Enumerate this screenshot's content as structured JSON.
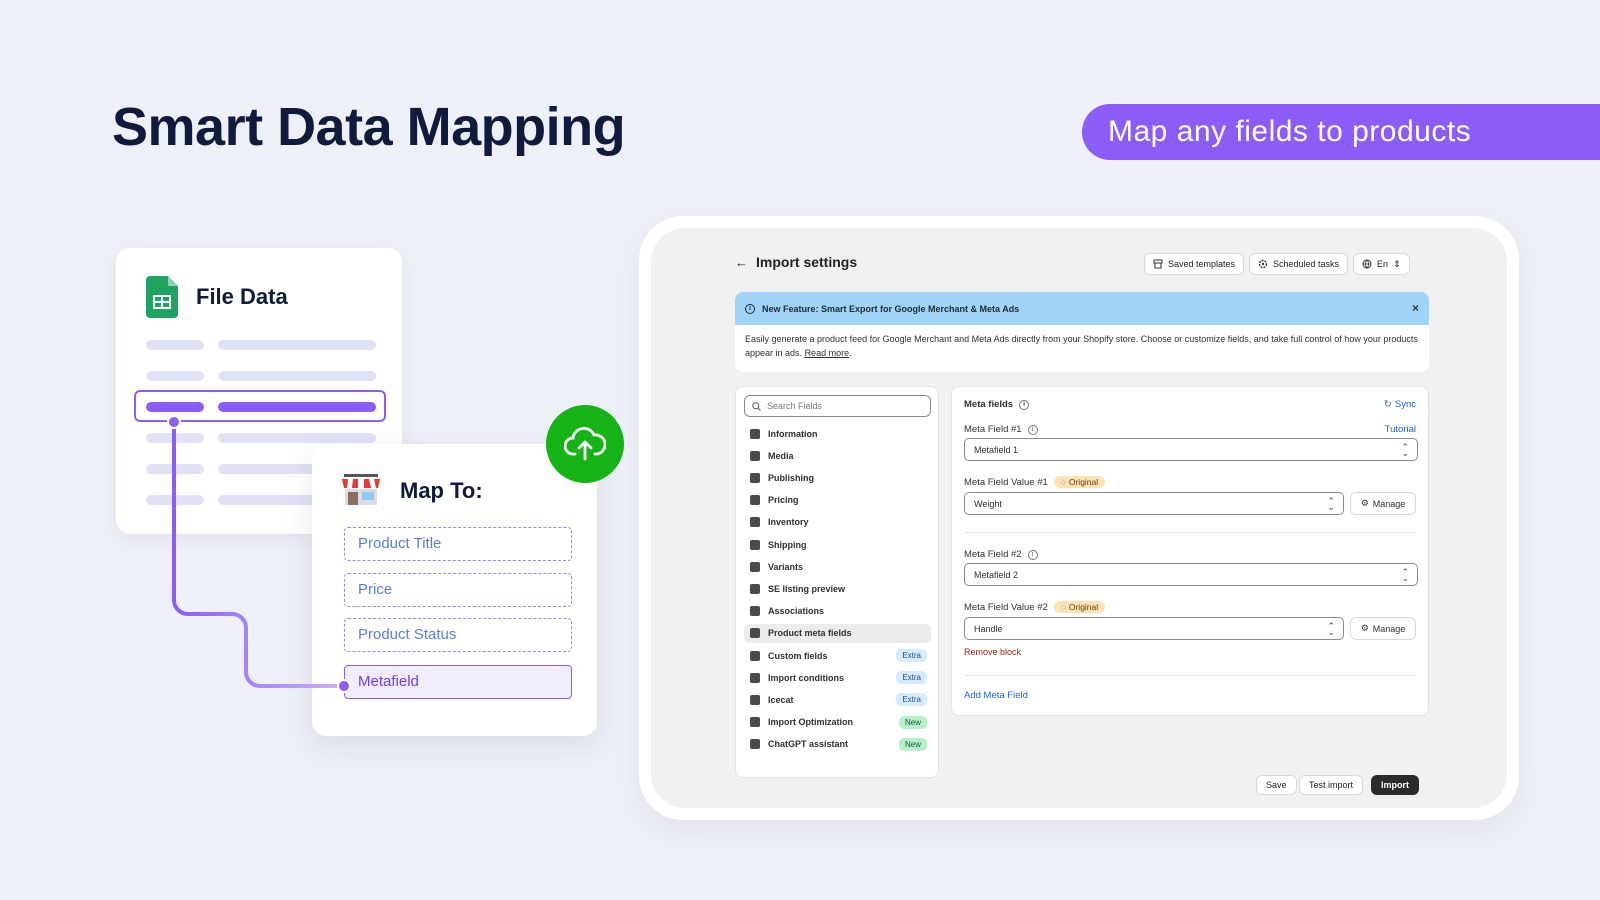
{
  "hero": {
    "title": "Smart Data Mapping",
    "pill": "Map any fields to products"
  },
  "file_card": {
    "title": "File Data"
  },
  "map_card": {
    "title": "Map To:",
    "fields": [
      "Product Title",
      "Price",
      "Product Status",
      "Metafield"
    ]
  },
  "app": {
    "title": "Import settings",
    "buttons": {
      "saved_templates": "Saved templates",
      "scheduled_tasks": "Scheduled tasks",
      "language": "En"
    },
    "notice": {
      "title": "New Feature: Smart Export for Google Merchant & Meta Ads",
      "body": "Easily generate a product feed for Google Merchant and Meta Ads directly from your Shopify store. Choose or customize fields, and take full control of how your products appear in ads.",
      "link": "Read more",
      "close": "×"
    },
    "sidebar": {
      "search_placeholder": "Search Fields",
      "items": [
        {
          "label": "Information",
          "badge": ""
        },
        {
          "label": "Media",
          "badge": ""
        },
        {
          "label": "Publishing",
          "badge": ""
        },
        {
          "label": "Pricing",
          "badge": ""
        },
        {
          "label": "Inventory",
          "badge": ""
        },
        {
          "label": "Shipping",
          "badge": ""
        },
        {
          "label": "Variants",
          "badge": ""
        },
        {
          "label": "SE listing preview",
          "badge": ""
        },
        {
          "label": "Associations",
          "badge": ""
        },
        {
          "label": "Product meta fields",
          "badge": ""
        },
        {
          "label": "Custom fields",
          "badge": "Extra"
        },
        {
          "label": "Import conditions",
          "badge": "Extra"
        },
        {
          "label": "Icecat",
          "badge": "Extra"
        },
        {
          "label": "Import Optimization",
          "badge": "New"
        },
        {
          "label": "ChatGPT assistant",
          "badge": "New"
        }
      ]
    },
    "main": {
      "section_title": "Meta fields",
      "sync": "Sync",
      "tutorial": "Tutorial",
      "field1_label": "Meta Field #1",
      "field1_value": "Metafield 1",
      "value1_label": "Meta Field Value #1",
      "original": "Original",
      "value1_value": "Weight",
      "manage": "Manage",
      "field2_label": "Meta Field #2",
      "field2_value": "Metafield 2",
      "value2_label": "Meta Field Value #2",
      "value2_value": "Handle",
      "remove_block": "Remove block",
      "add_meta_field": "Add Meta Field"
    },
    "footer": {
      "save": "Save",
      "test_import": "Test import",
      "import": "Import"
    }
  },
  "colors": {
    "accent": "#8b5cf6",
    "success": "#16b316",
    "navy": "#0f1a3c"
  }
}
